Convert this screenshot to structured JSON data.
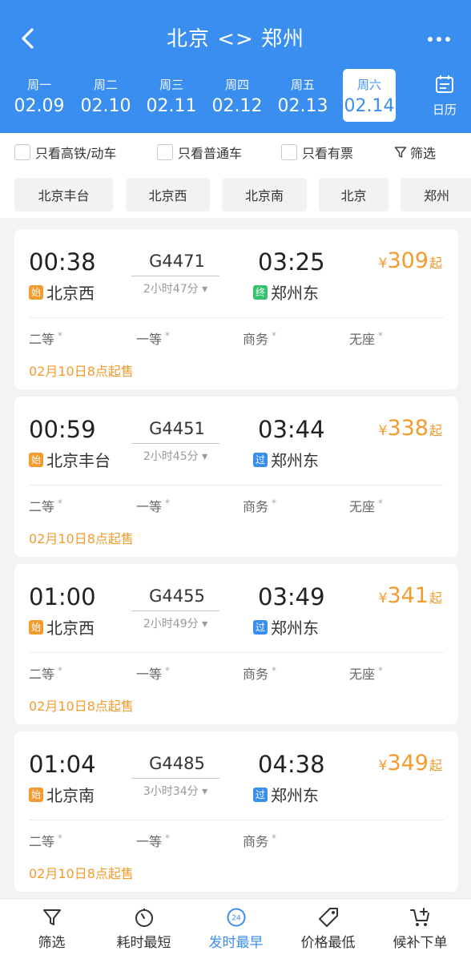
{
  "header": {
    "title": "北京 <> 郑州",
    "back_icon": "chevron-left-icon",
    "more_icon": "more-dots-icon",
    "accent": "#3a8ef0"
  },
  "dates": [
    {
      "weekday": "周一",
      "date": "02.09",
      "active": false
    },
    {
      "weekday": "周二",
      "date": "02.10",
      "active": false
    },
    {
      "weekday": "周三",
      "date": "02.11",
      "active": false
    },
    {
      "weekday": "周四",
      "date": "02.12",
      "active": false
    },
    {
      "weekday": "周五",
      "date": "02.13",
      "active": false
    },
    {
      "weekday": "周六",
      "date": "02.14",
      "active": true
    }
  ],
  "calendar": {
    "label": "日历",
    "icon": "calendar-icon"
  },
  "filters": {
    "only_highspeed": "只看高铁/动车",
    "only_normal": "只看普通车",
    "only_available": "只看有票",
    "screen": "筛选"
  },
  "stations": [
    "北京丰台",
    "北京西",
    "北京南",
    "北京",
    "郑州"
  ],
  "trains": [
    {
      "dep_time": "00:38",
      "train_no": "G4471",
      "arr_time": "03:25",
      "duration": "2小时47分",
      "dep_tag": "始",
      "dep_station": "北京西",
      "arr_tag": "终",
      "arr_station": "郑州东",
      "yen": "¥",
      "price": "309",
      "price_suffix": "起",
      "seats": [
        "二等",
        "一等",
        "商务",
        "无座"
      ],
      "seat_mark": "*",
      "sale": "02月10日8点起售"
    },
    {
      "dep_time": "00:59",
      "train_no": "G4451",
      "arr_time": "03:44",
      "duration": "2小时45分",
      "dep_tag": "始",
      "dep_station": "北京丰台",
      "arr_tag": "过",
      "arr_station": "郑州东",
      "yen": "¥",
      "price": "338",
      "price_suffix": "起",
      "seats": [
        "二等",
        "一等",
        "商务",
        "无座"
      ],
      "seat_mark": "*",
      "sale": "02月10日8点起售"
    },
    {
      "dep_time": "01:00",
      "train_no": "G4455",
      "arr_time": "03:49",
      "duration": "2小时49分",
      "dep_tag": "始",
      "dep_station": "北京西",
      "arr_tag": "过",
      "arr_station": "郑州东",
      "yen": "¥",
      "price": "341",
      "price_suffix": "起",
      "seats": [
        "二等",
        "一等",
        "商务",
        "无座"
      ],
      "seat_mark": "*",
      "sale": "02月10日8点起售"
    },
    {
      "dep_time": "01:04",
      "train_no": "G4485",
      "arr_time": "04:38",
      "duration": "3小时34分",
      "dep_tag": "始",
      "dep_station": "北京南",
      "arr_tag": "过",
      "arr_station": "郑州东",
      "yen": "¥",
      "price": "349",
      "price_suffix": "起",
      "seats": [
        "二等",
        "一等",
        "商务"
      ],
      "seat_mark": "*",
      "sale": "02月10日8点起售"
    }
  ],
  "tabbar": [
    {
      "label": "筛选",
      "icon": "filter-icon",
      "active": false
    },
    {
      "label": "耗时最短",
      "icon": "timer-icon",
      "active": false
    },
    {
      "label": "发时最早",
      "icon": "clock-24-icon",
      "active": true
    },
    {
      "label": "价格最低",
      "icon": "price-tag-icon",
      "active": false
    },
    {
      "label": "候补下单",
      "icon": "cart-add-icon",
      "active": false
    }
  ],
  "colors": {
    "orange": "#f39b2e",
    "start_tag": "#f39b2e",
    "end_tag": "#34c26d",
    "pass_tag": "#3a8ef0"
  }
}
